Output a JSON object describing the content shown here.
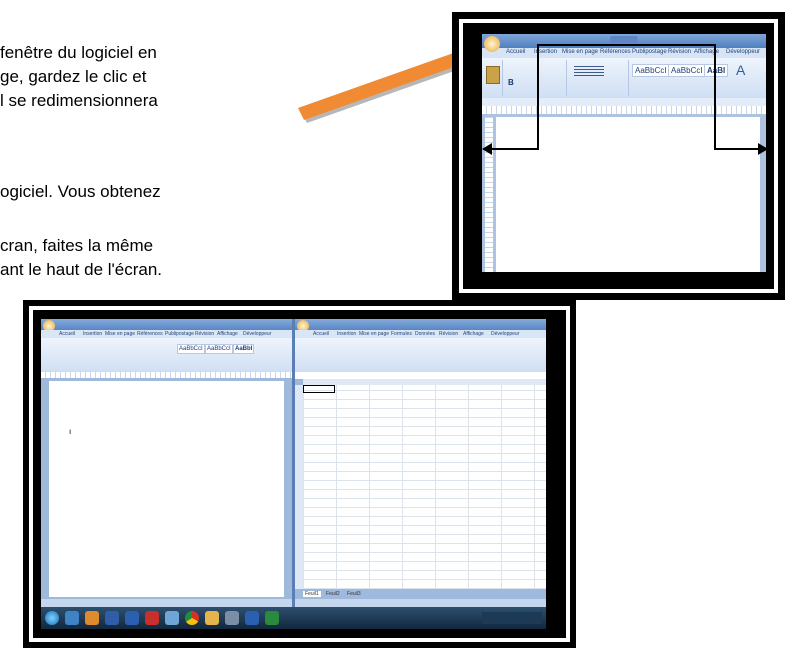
{
  "paragraphs": {
    "line1": "fenêtre du logiciel en",
    "line2": "ge, gardez le clic et",
    "line3": "l se redimensionnera",
    "line4": "ogiciel. Vous obtenez",
    "line5": "cran, faites la même",
    "line6": "ant le haut de l'écran."
  },
  "colors": {
    "arrow": "#f08a33",
    "frame": "#000000"
  },
  "word_window": {
    "tabs": [
      "Accueil",
      "Insertion",
      "Mise en page",
      "Références",
      "Publipostage",
      "Révision",
      "Affichage",
      "Développeur"
    ],
    "styles": [
      "AaBbCcI",
      "AaBbCcI",
      "AaBl"
    ],
    "icons": [
      "office-button-icon",
      "paste-icon",
      "bold-icon",
      "align-icon",
      "find-icon"
    ]
  },
  "split_screenshot": {
    "left_tabs": [
      "Accueil",
      "Insertion",
      "Mise en page",
      "Références",
      "Publipostage",
      "Révision",
      "Affichage",
      "Développeur"
    ],
    "right_tabs": [
      "Accueil",
      "Insertion",
      "Mise en page",
      "Formules",
      "Données",
      "Révision",
      "Affichage",
      "Développeur"
    ],
    "left_styles": [
      "AaBbCcI",
      "AaBbCcI",
      "AaBbI"
    ],
    "sheet_tabs": [
      "Feuil1",
      "Feuil2",
      "Feuil3"
    ],
    "taskbar_icons": [
      "start-orb-icon",
      "explorer-icon",
      "media-icon",
      "browser-icon",
      "word-icon",
      "pdf-icon",
      "paint-icon",
      "chrome-icon",
      "folder-icon",
      "settings-icon",
      "word-icon-2",
      "excel-icon"
    ]
  }
}
